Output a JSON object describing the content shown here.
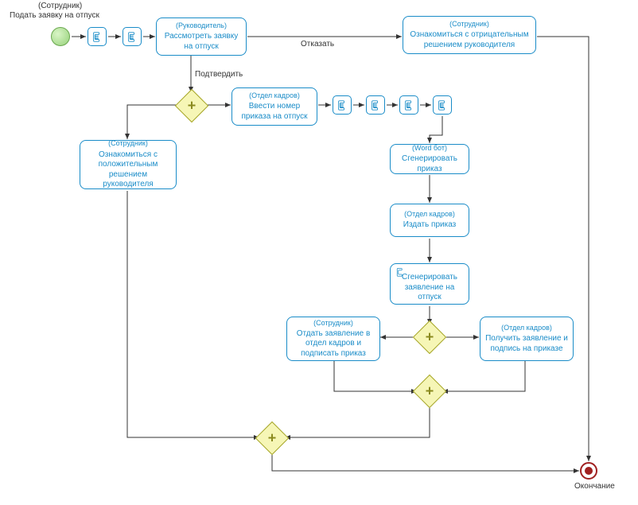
{
  "header": {
    "role": "(Сотрудник)",
    "title": "Подать заявку на отпуск"
  },
  "labels": {
    "refuse": "Отказать",
    "confirm": "Подтвердить",
    "end": "Окончание"
  },
  "tasks": {
    "review": {
      "role": "(Руководитель)",
      "title": "Рассмотреть заявку на отпуск"
    },
    "ack_negative": {
      "role": "(Сотрудник)",
      "title": "Ознакомиться с отрицательным решением руководителя"
    },
    "ack_positive": {
      "role": "(Сотрудник)",
      "title": "Ознакомиться с положительным решением руководителя"
    },
    "enter_order_no": {
      "role": "(Отдел кадров)",
      "title": "Ввести номер приказа на отпуск"
    },
    "gen_order": {
      "role": "(Word бот)",
      "title": "Сгенерировать приказ"
    },
    "issue_order": {
      "role": "(Отдел кадров)",
      "title": "Издать приказ"
    },
    "gen_statement": {
      "role": "",
      "title": "Сгенерировать заявление на отпуск"
    },
    "submit_sign": {
      "role": "(Сотрудник)",
      "title": "Отдать заявление в отдел кадров и подписать приказ"
    },
    "receive_sign": {
      "role": "(Отдел кадров)",
      "title": "Получить заявление и подпись на приказе"
    }
  },
  "icons": {
    "script": "script-icon"
  }
}
